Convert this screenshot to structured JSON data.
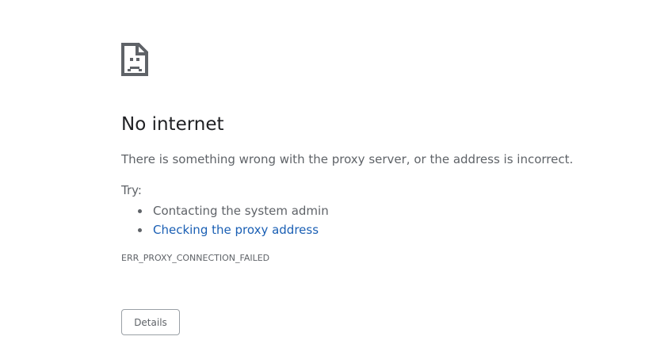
{
  "icon": "sad-page-icon",
  "title": "No internet",
  "message": "There is something wrong with the proxy server, or the address is incorrect.",
  "try_label": "Try:",
  "suggestions": [
    {
      "text": "Contacting the system admin",
      "link": false
    },
    {
      "text": "Checking the proxy address",
      "link": true
    }
  ],
  "error_code": "ERR_PROXY_CONNECTION_FAILED",
  "details_button": "Details",
  "colors": {
    "title": "#202124",
    "text": "#5f6368",
    "link": "#1a5fb4",
    "button_border": "#9aa0a6"
  }
}
